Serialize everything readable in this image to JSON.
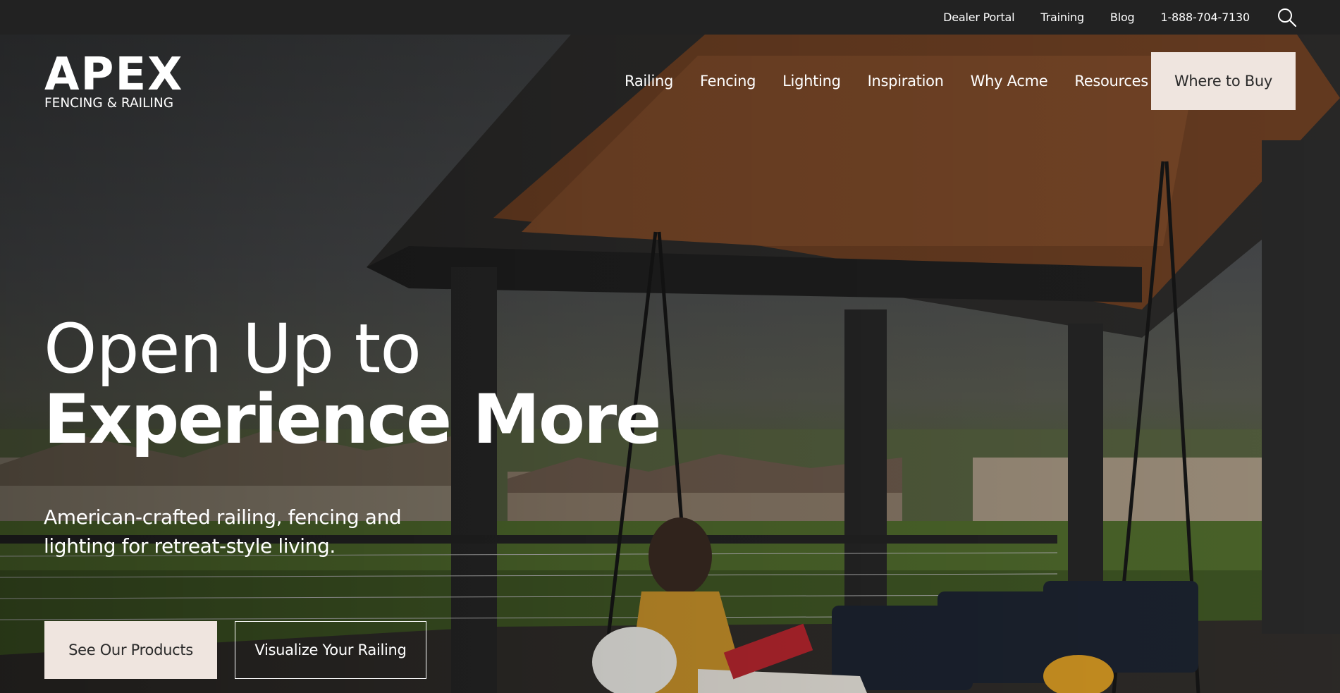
{
  "utility_nav": {
    "items": [
      {
        "label": "Dealer Portal"
      },
      {
        "label": "Training"
      },
      {
        "label": "Blog"
      },
      {
        "label": "1-888-704-7130"
      }
    ]
  },
  "brand": {
    "name": "APEX",
    "tagline": "FENCING & RAILING"
  },
  "main_nav": {
    "items": [
      {
        "label": "Railing"
      },
      {
        "label": "Fencing"
      },
      {
        "label": "Lighting"
      },
      {
        "label": "Inspiration"
      },
      {
        "label": "Why Acme"
      },
      {
        "label": "Resources"
      }
    ],
    "cta_label": "Where to Buy"
  },
  "hero": {
    "headline_line1": "Open Up to",
    "headline_line2": "Experience More",
    "subheadline": "American-crafted railing, fencing and lighting for retreat-style living.",
    "primary_cta": "See Our Products",
    "secondary_cta": "Visualize Your Railing"
  },
  "colors": {
    "utility_bar": "#222222",
    "button_fill": "#efe5df",
    "button_text": "#2a2a2a",
    "text": "#ffffff"
  },
  "icons": {
    "search": "search-icon"
  }
}
